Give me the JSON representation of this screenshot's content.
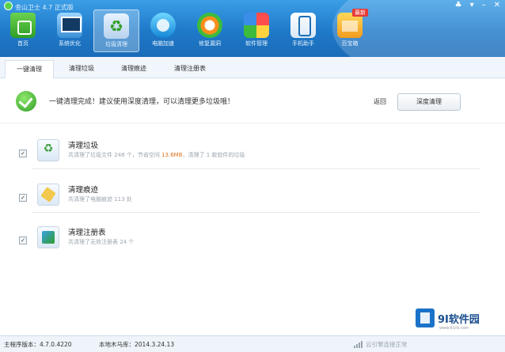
{
  "window": {
    "title": "金山卫士 4.7 正式版"
  },
  "nav": {
    "items": [
      {
        "label": "首页",
        "icon": "home-shield-icon"
      },
      {
        "label": "系统优化",
        "icon": "monitor-icon"
      },
      {
        "label": "垃圾清理",
        "icon": "recycle-bin-icon"
      },
      {
        "label": "电脑加速",
        "icon": "speedup-icon"
      },
      {
        "label": "修复漏洞",
        "icon": "repair-icon"
      },
      {
        "label": "软件管理",
        "icon": "software-icon"
      },
      {
        "label": "手机助手",
        "icon": "phone-icon"
      },
      {
        "label": "百宝箱",
        "icon": "toolbox-icon"
      }
    ],
    "badge": "最新"
  },
  "tabs": [
    "一键清理",
    "清理垃圾",
    "清理痕迹",
    "清理注册表"
  ],
  "status": {
    "message": "一键清理完成！建议使用深度清理，可以清理更多垃圾哦！",
    "back": "返回",
    "deep_clean": "深度清理"
  },
  "items": [
    {
      "title": "清理垃圾",
      "sub_prefix": "共清理了垃圾文件",
      "sub_count": "248 个",
      "sub_mid": "，节省空间",
      "sub_size": "13.6MB",
      "sub_suffix": "，清理了 1 款软件的垃圾"
    },
    {
      "title": "清理痕迹",
      "sub": "共清理了电脑痕迹 113 处"
    },
    {
      "title": "清理注册表",
      "sub": "共清理了无效注册表 24 个"
    }
  ],
  "watermark": {
    "brand": "9I软件园",
    "url": "www.91rb.com"
  },
  "footer": {
    "version": "主程序版本：4.7.0.4220",
    "db": "本地木马库：2014.3.24.13",
    "cloud": "云引擎连接正常"
  }
}
